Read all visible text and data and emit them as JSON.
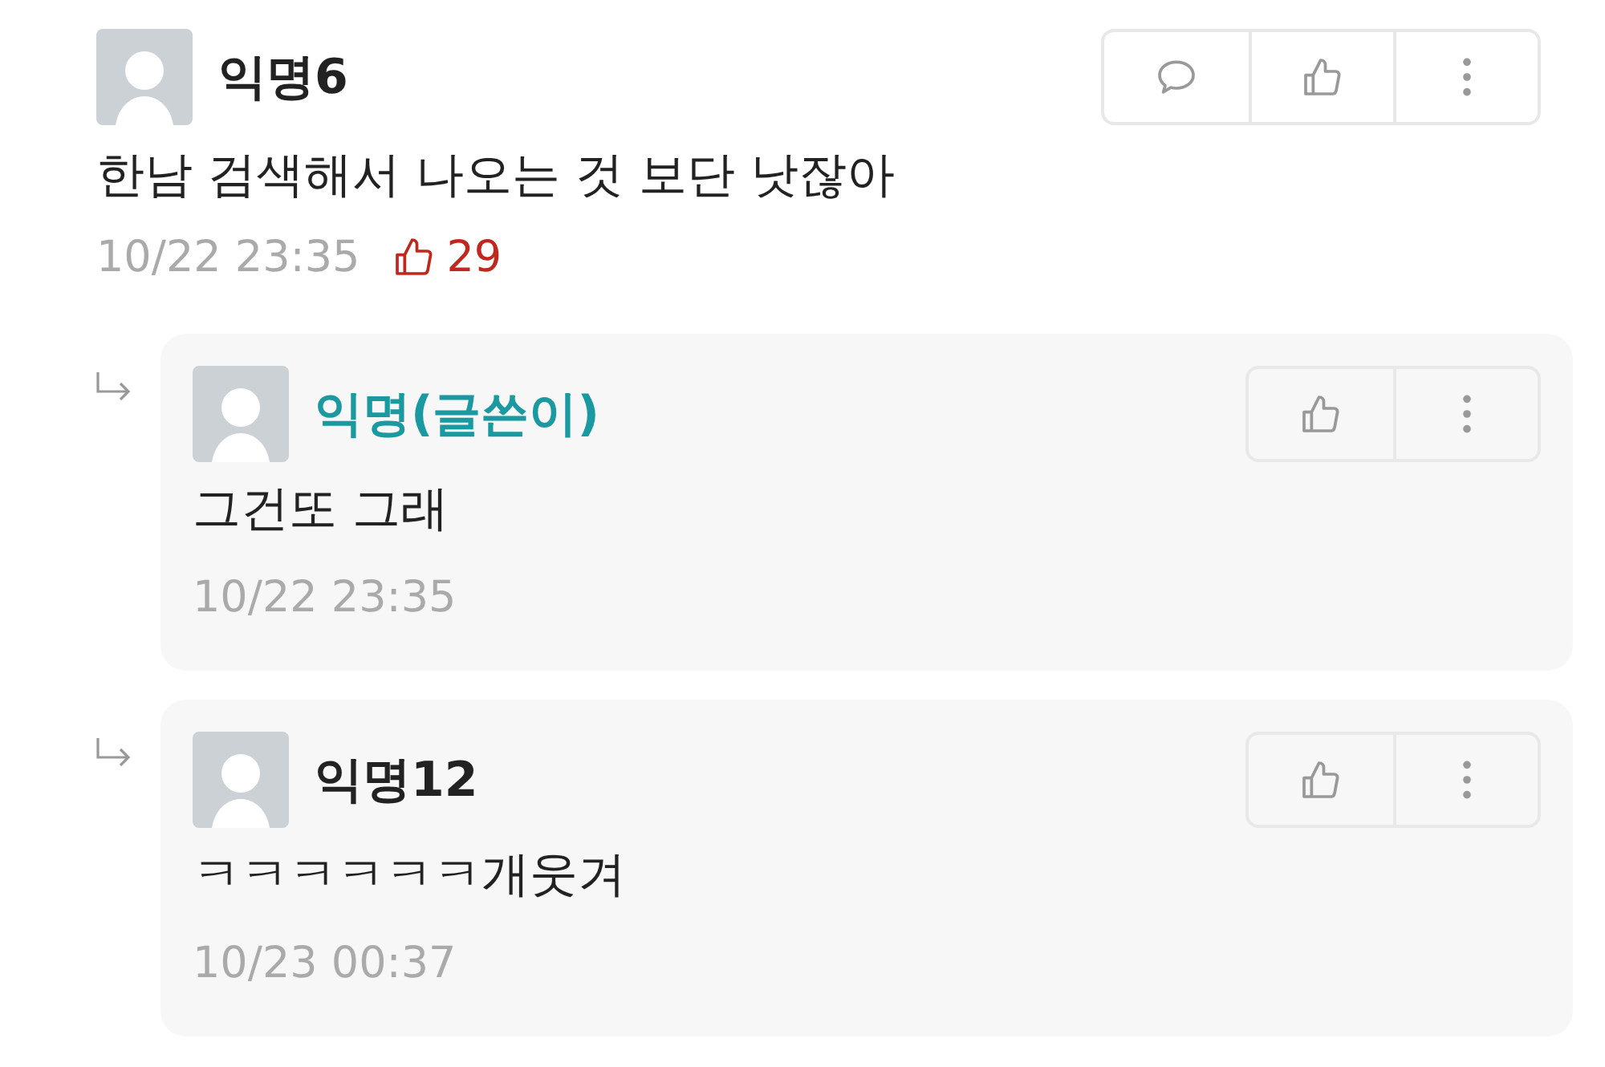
{
  "comment": {
    "author": "익명6",
    "is_writer": false,
    "actions": [
      {
        "kind": "comment"
      },
      {
        "kind": "like"
      },
      {
        "kind": "more"
      }
    ],
    "text": "한남 검색해서 나오는 것 보단 낫잖아",
    "time": "10/22 23:35",
    "likes": "29"
  },
  "replies": [
    {
      "author": "익명(글쓴이)",
      "is_writer": true,
      "actions": [
        {
          "kind": "like"
        },
        {
          "kind": "more"
        }
      ],
      "text": "그건또 그래",
      "time": "10/22 23:35"
    },
    {
      "author": "익명12",
      "is_writer": false,
      "actions": [
        {
          "kind": "like"
        },
        {
          "kind": "more"
        }
      ],
      "text": "ㅋㅋㅋㅋㅋㅋ개웃겨",
      "time": "10/23 00:37"
    }
  ]
}
